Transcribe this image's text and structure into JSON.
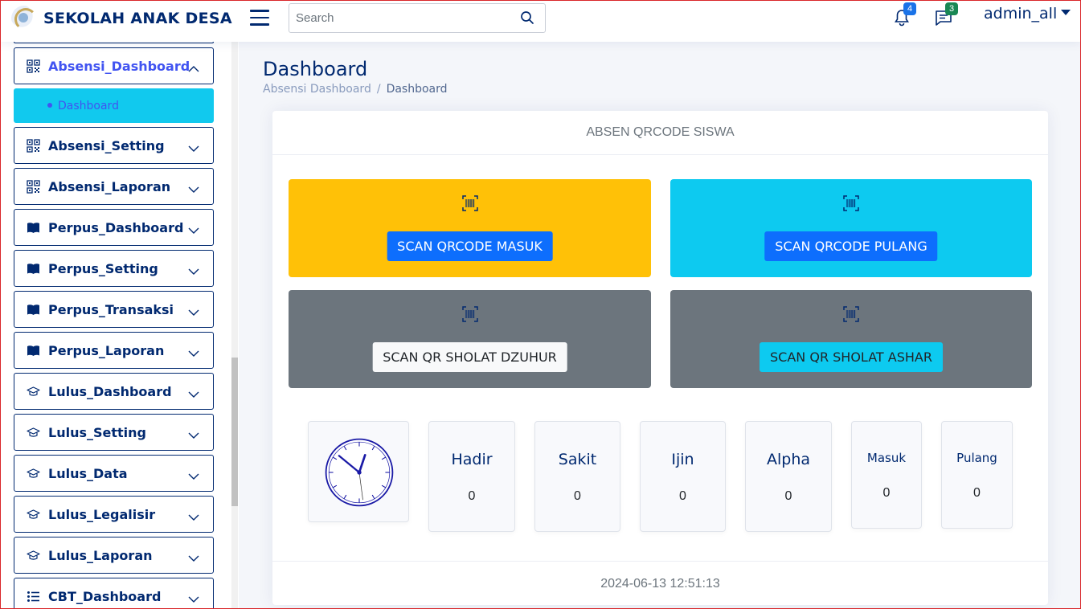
{
  "app": {
    "title": "SEKOLAH ANAK DESA",
    "user": "admin_all"
  },
  "search": {
    "placeholder": "Search"
  },
  "badges": {
    "notifications": "4",
    "messages": "3"
  },
  "sidebar": {
    "items": [
      {
        "label": "Absensi_Dashboard",
        "icon": "qr-icon"
      },
      {
        "label": "Absensi_Setting",
        "icon": "qr-icon"
      },
      {
        "label": "Absensi_Laporan",
        "icon": "qr-icon"
      },
      {
        "label": "Perpus_Dashboard",
        "icon": "book-icon"
      },
      {
        "label": "Perpus_Setting",
        "icon": "book-icon"
      },
      {
        "label": "Perpus_Transaksi",
        "icon": "book-icon"
      },
      {
        "label": "Perpus_Laporan",
        "icon": "book-icon"
      },
      {
        "label": "Lulus_Dashboard",
        "icon": "mortarboard-icon"
      },
      {
        "label": "Lulus_Setting",
        "icon": "mortarboard-icon"
      },
      {
        "label": "Lulus_Data",
        "icon": "mortarboard-icon"
      },
      {
        "label": "Lulus_Legalisir",
        "icon": "mortarboard-icon"
      },
      {
        "label": "Lulus_Laporan",
        "icon": "mortarboard-icon"
      },
      {
        "label": "CBT_Dashboard",
        "icon": "list-icon"
      }
    ],
    "sub_item": "Dashboard"
  },
  "page": {
    "title": "Dashboard",
    "breadcrumb": [
      "Absensi Dashboard",
      "Dashboard"
    ]
  },
  "card": {
    "header": "ABSEN QRCODE SISWA",
    "buttons": {
      "masuk": "SCAN QRCODE MASUK",
      "pulang": "SCAN QRCODE PULANG",
      "dzuhur": "SCAN QR SHOLAT DZUHUR",
      "ashar": "SCAN QR SHOLAT ASHAR"
    },
    "stats": {
      "hadir": {
        "label": "Hadir",
        "value": "0"
      },
      "sakit": {
        "label": "Sakit",
        "value": "0"
      },
      "ijin": {
        "label": "Ijin",
        "value": "0"
      },
      "alpha": {
        "label": "Alpha",
        "value": "0"
      },
      "masuk": {
        "label": "Masuk",
        "value": "0"
      },
      "pulang": {
        "label": "Pulang",
        "value": "0"
      }
    },
    "footer": "2024-06-13 12:51:13"
  },
  "colors": {
    "primary": "#012970",
    "accent": "#4154f1",
    "warning": "#ffc107",
    "info": "#0dcaf0",
    "secondary": "#6c757d",
    "button_blue": "#0d6efd"
  }
}
